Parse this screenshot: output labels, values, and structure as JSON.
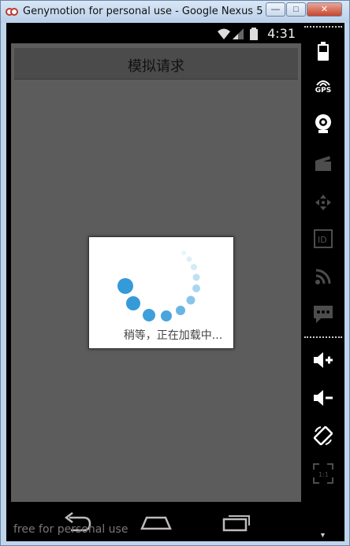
{
  "window": {
    "title": "Genymotion for personal use - Google Nexus 5 - 4...",
    "min_label": "—",
    "max_label": "□",
    "close_label": "✕"
  },
  "statusbar": {
    "time": "4:31"
  },
  "app": {
    "title": "模拟请求"
  },
  "dialog": {
    "message": "稍等，正在加载中..."
  },
  "watermark": "free for personal use",
  "colors": {
    "spinner": "#2a95d6",
    "app_background": "#5c5c5c",
    "actionbar": "#4b4b4b"
  },
  "sidebar": {
    "gps_label": "GPS",
    "items": [
      "battery-icon",
      "gps-icon",
      "camera-icon",
      "clapper-icon",
      "dpad-icon",
      "id-icon",
      "rss-icon",
      "sms-icon",
      "volume-up-icon",
      "volume-down-icon",
      "rotate-icon",
      "pixel-perfect-icon"
    ]
  }
}
